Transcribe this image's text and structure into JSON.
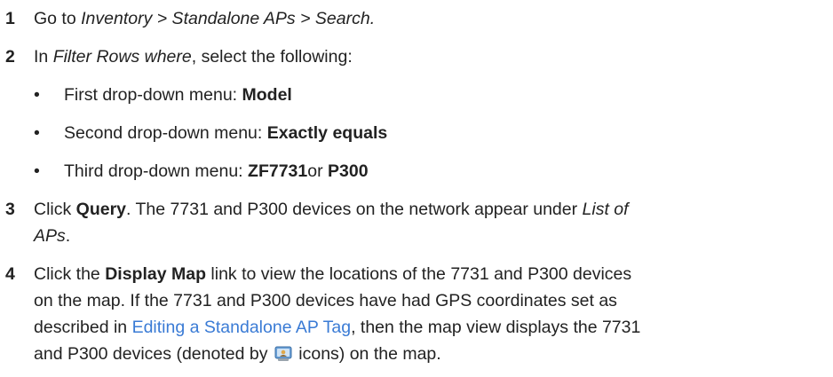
{
  "steps": [
    {
      "num": "1",
      "lead": "Go to ",
      "path": "Inventory > Standalone APs > Search."
    },
    {
      "num": "2",
      "lead": "In ",
      "italic": "Filter Rows where",
      "tail": ", select the following:"
    },
    {
      "num": "3",
      "lead": "Click ",
      "bold": "Query",
      "tail1": ". The 7731 and P300 devices on the network appear under ",
      "italic1": "List of",
      "italic2": "APs",
      "tail2": "."
    },
    {
      "num": "4",
      "lead": "Click the ",
      "bold": "Display Map",
      "tail1": " link to view the locations of the 7731 and P300 devices",
      "line2": "on the map. If the 7731 and P300 devices have had GPS coordinates set as",
      "line3_lead": "described in ",
      "link": "Editing a Standalone AP Tag",
      "line3_tail": ", then the map view displays the 7731",
      "line4_lead": "and P300 devices (denoted by ",
      "line4_tail": " icons) on the map."
    }
  ],
  "bullets": [
    {
      "dot": "•",
      "lead": "First drop-down menu: ",
      "bold": "Model"
    },
    {
      "dot": "•",
      "lead": "Second drop-down menu: ",
      "bold": "Exactly equals"
    },
    {
      "dot": "•",
      "lead": "Third drop-down menu: ",
      "bold1": "ZF7731",
      "mid": "or ",
      "bold2": "P300"
    }
  ],
  "icons": {
    "ap_map_icon": "access-point-map-icon"
  },
  "colors": {
    "text": "#222222",
    "link": "#3a7bd5"
  }
}
